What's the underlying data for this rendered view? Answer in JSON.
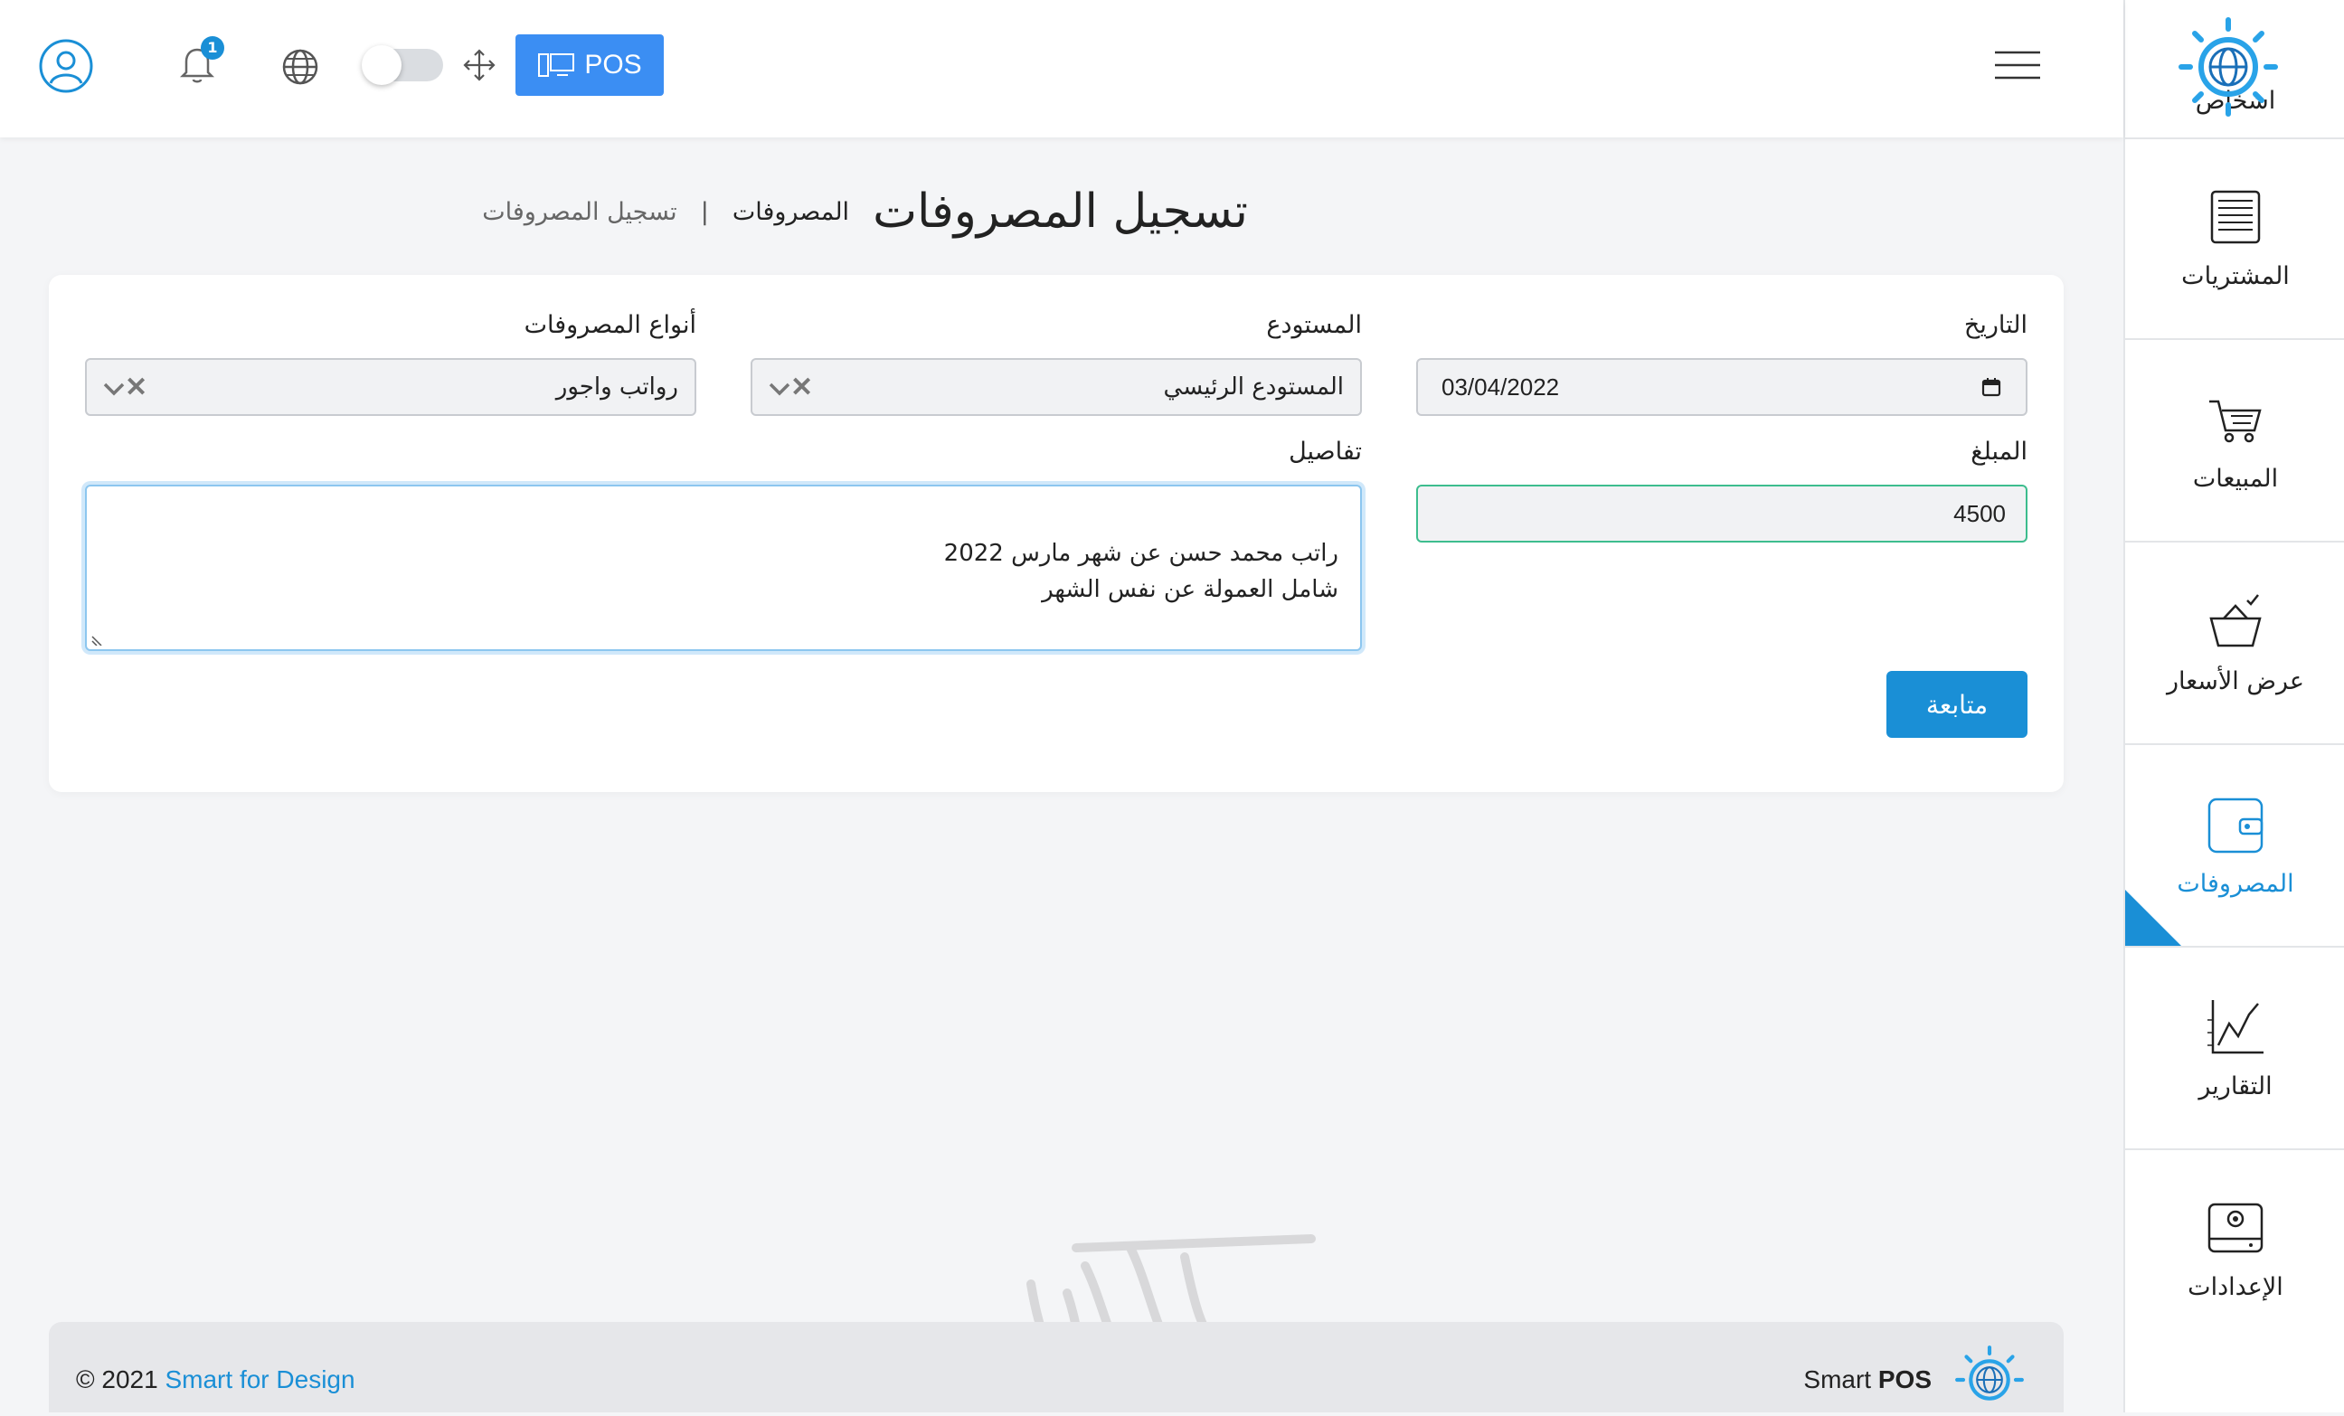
{
  "topbar": {
    "pos_label": "POS",
    "notification_count": "1"
  },
  "sidebar": {
    "items": [
      {
        "label": "اشخاص",
        "icon": "people-icon"
      },
      {
        "label": "المشتريات",
        "icon": "invoice-icon"
      },
      {
        "label": "المبيعات",
        "icon": "cart-icon"
      },
      {
        "label": "عرض الأسعار",
        "icon": "basket-check-icon"
      },
      {
        "label": "المصروفات",
        "icon": "wallet-icon",
        "active": true
      },
      {
        "label": "التقارير",
        "icon": "chart-line-icon"
      },
      {
        "label": "الإعدادات",
        "icon": "settings-device-icon"
      }
    ]
  },
  "page": {
    "title": "تسجيل المصروفات",
    "breadcrumb_parent": "المصروفات",
    "breadcrumb_sep": "|",
    "breadcrumb_current": "تسجيل المصروفات"
  },
  "form": {
    "date_label": "التاريخ",
    "date_value": "03/04/2022",
    "warehouse_label": "المستودع",
    "warehouse_value": "المستودع الرئيسي",
    "expense_type_label": "أنواع المصروفات",
    "expense_type_value": "رواتب واجور",
    "amount_label": "المبلغ",
    "amount_value": "4500",
    "details_label": "تفاصيل",
    "details_value": "راتب محمد حسن عن شهر مارس 2022\nشامل العمولة عن نفس الشهر",
    "submit_label": "متابعة",
    "clear_symbol": "✕"
  },
  "footer": {
    "copyright_prefix": "© 2021 ",
    "copyright_brand": "Smart for Design",
    "brand_text": "Smart ",
    "brand_bold": "POS"
  },
  "colors": {
    "accent": "#1a8fd6",
    "pos_button": "#3b8ef3",
    "valid_border": "#3dbd8e"
  }
}
